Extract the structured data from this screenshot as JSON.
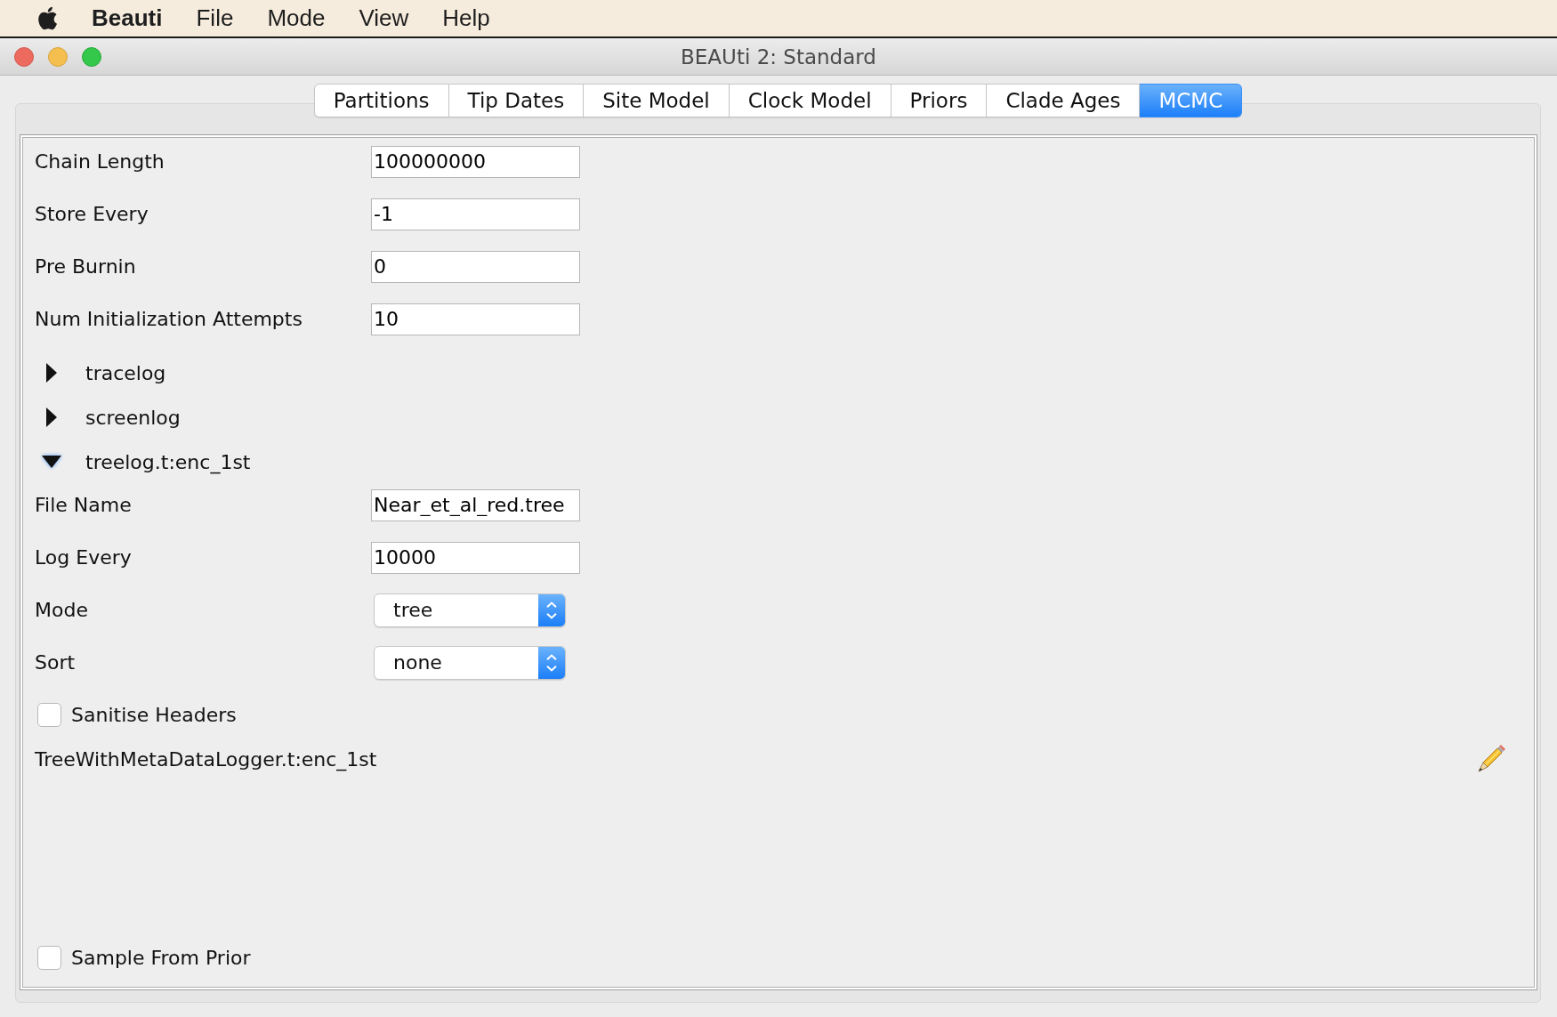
{
  "menu_bar": {
    "app_name": "Beauti",
    "items": [
      "File",
      "Mode",
      "View",
      "Help"
    ]
  },
  "window": {
    "title": "BEAUti 2: Standard"
  },
  "tabs": [
    {
      "label": "Partitions",
      "selected": false
    },
    {
      "label": "Tip Dates",
      "selected": false
    },
    {
      "label": "Site Model",
      "selected": false
    },
    {
      "label": "Clock Model",
      "selected": false
    },
    {
      "label": "Priors",
      "selected": false
    },
    {
      "label": "Clade Ages",
      "selected": false
    },
    {
      "label": "MCMC",
      "selected": true
    }
  ],
  "mcmc": {
    "fields": [
      {
        "label": "Chain Length",
        "value": "100000000"
      },
      {
        "label": "Store Every",
        "value": "-1"
      },
      {
        "label": "Pre Burnin",
        "value": "0"
      },
      {
        "label": "Num Initialization Attempts",
        "value": "10"
      }
    ],
    "loggers": [
      {
        "name": "tracelog",
        "expanded": false
      },
      {
        "name": "screenlog",
        "expanded": false
      },
      {
        "name": "treelog.t:enc_1st",
        "expanded": true,
        "settings": [
          {
            "kind": "text",
            "label": "File Name",
            "value": "Near_et_al_red.tree"
          },
          {
            "kind": "text",
            "label": "Log Every",
            "value": "10000"
          },
          {
            "kind": "dropdown",
            "label": "Mode",
            "value": "tree"
          },
          {
            "kind": "dropdown",
            "label": "Sort",
            "value": "none"
          },
          {
            "kind": "checkbox",
            "label": "Sanitise Headers",
            "checked": false
          }
        ],
        "logger": "TreeWithMetaDataLogger.t:enc_1st"
      }
    ],
    "sample_from_prior": {
      "label": "Sample From Prior",
      "checked": false
    }
  }
}
